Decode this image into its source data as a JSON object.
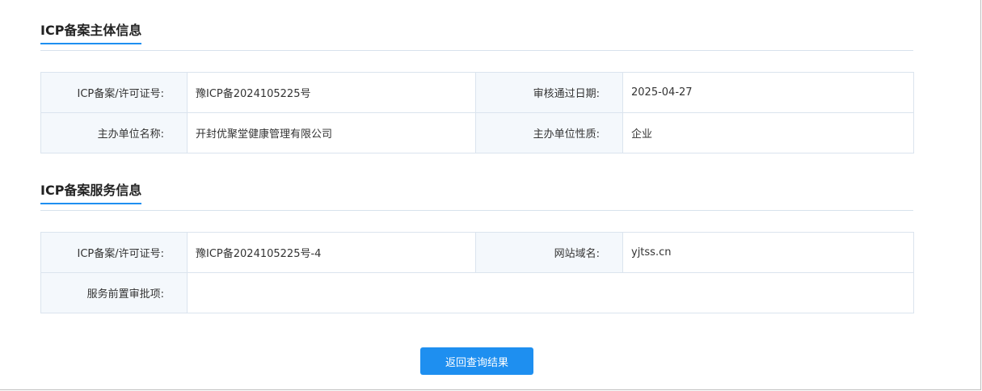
{
  "subject": {
    "title": "ICP备案主体信息",
    "rows": [
      {
        "label1": "ICP备案/许可证号:",
        "value1": "豫ICP备2024105225号",
        "label2": "审核通过日期:",
        "value2": "2025-04-27"
      },
      {
        "label1": "主办单位名称:",
        "value1": "开封优聚堂健康管理有限公司",
        "label2": "主办单位性质:",
        "value2": "企业"
      }
    ]
  },
  "service": {
    "title": "ICP备案服务信息",
    "rows": [
      {
        "label1": "ICP备案/许可证号:",
        "value1": "豫ICP备2024105225号-4",
        "label2": "网站域名:",
        "value2": "yjtss.cn"
      },
      {
        "label1": "服务前置审批项:",
        "value1": ""
      }
    ]
  },
  "actions": {
    "back_label": "返回查询结果"
  },
  "colors": {
    "accent": "#1e8ff0",
    "label_bg": "#f4f8fc",
    "border": "#dbe4ee"
  }
}
